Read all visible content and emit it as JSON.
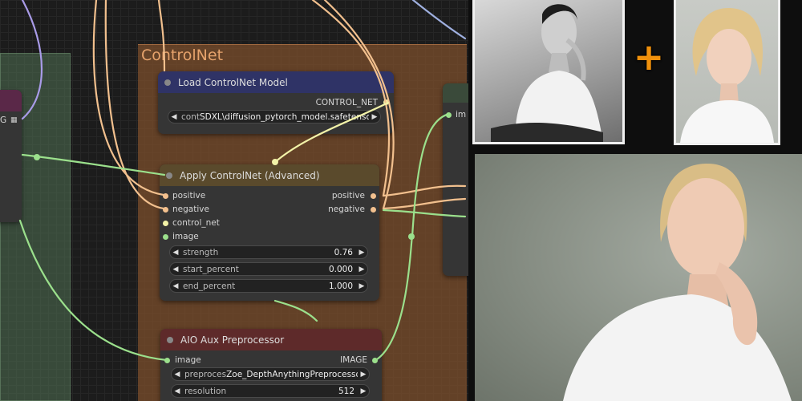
{
  "groups": {
    "controlnet_title": "ControlNet"
  },
  "left_node": {
    "partial_label": "G"
  },
  "load_controlnet": {
    "title": "Load ControlNet Model",
    "output_label": "CONTROL_NET",
    "widget_label": "cont",
    "widget_value": "SDXL\\diffusion_pytorch_model.safetensors"
  },
  "apply_controlnet": {
    "title": "Apply ControlNet (Advanced)",
    "inputs": [
      "positive",
      "negative",
      "control_net",
      "image"
    ],
    "outputs": [
      "positive",
      "negative"
    ],
    "widgets": [
      {
        "label": "strength",
        "value": "0.76"
      },
      {
        "label": "start_percent",
        "value": "0.000"
      },
      {
        "label": "end_percent",
        "value": "1.000"
      }
    ]
  },
  "right_node": {
    "input_label": "im"
  },
  "aio_preprocessor": {
    "title": "AIO Aux Preprocessor",
    "input_label": "image",
    "output_label": "IMAGE",
    "widgets": [
      {
        "label": "preproces",
        "value": "Zoe_DepthAnythingPreprocessor"
      },
      {
        "label": "resolution",
        "value": "512"
      }
    ]
  },
  "overlay": {
    "plus_symbol": "+"
  },
  "colors": {
    "node_body": "#353535",
    "header_blue": "#2f3366",
    "header_brown": "#5a4a2c",
    "header_red": "#5e2a2a",
    "wire_peach": "#f2c08e",
    "wire_green": "#9be08c",
    "wire_lavender": "#a99be8",
    "accent_orange": "#f0900c"
  }
}
